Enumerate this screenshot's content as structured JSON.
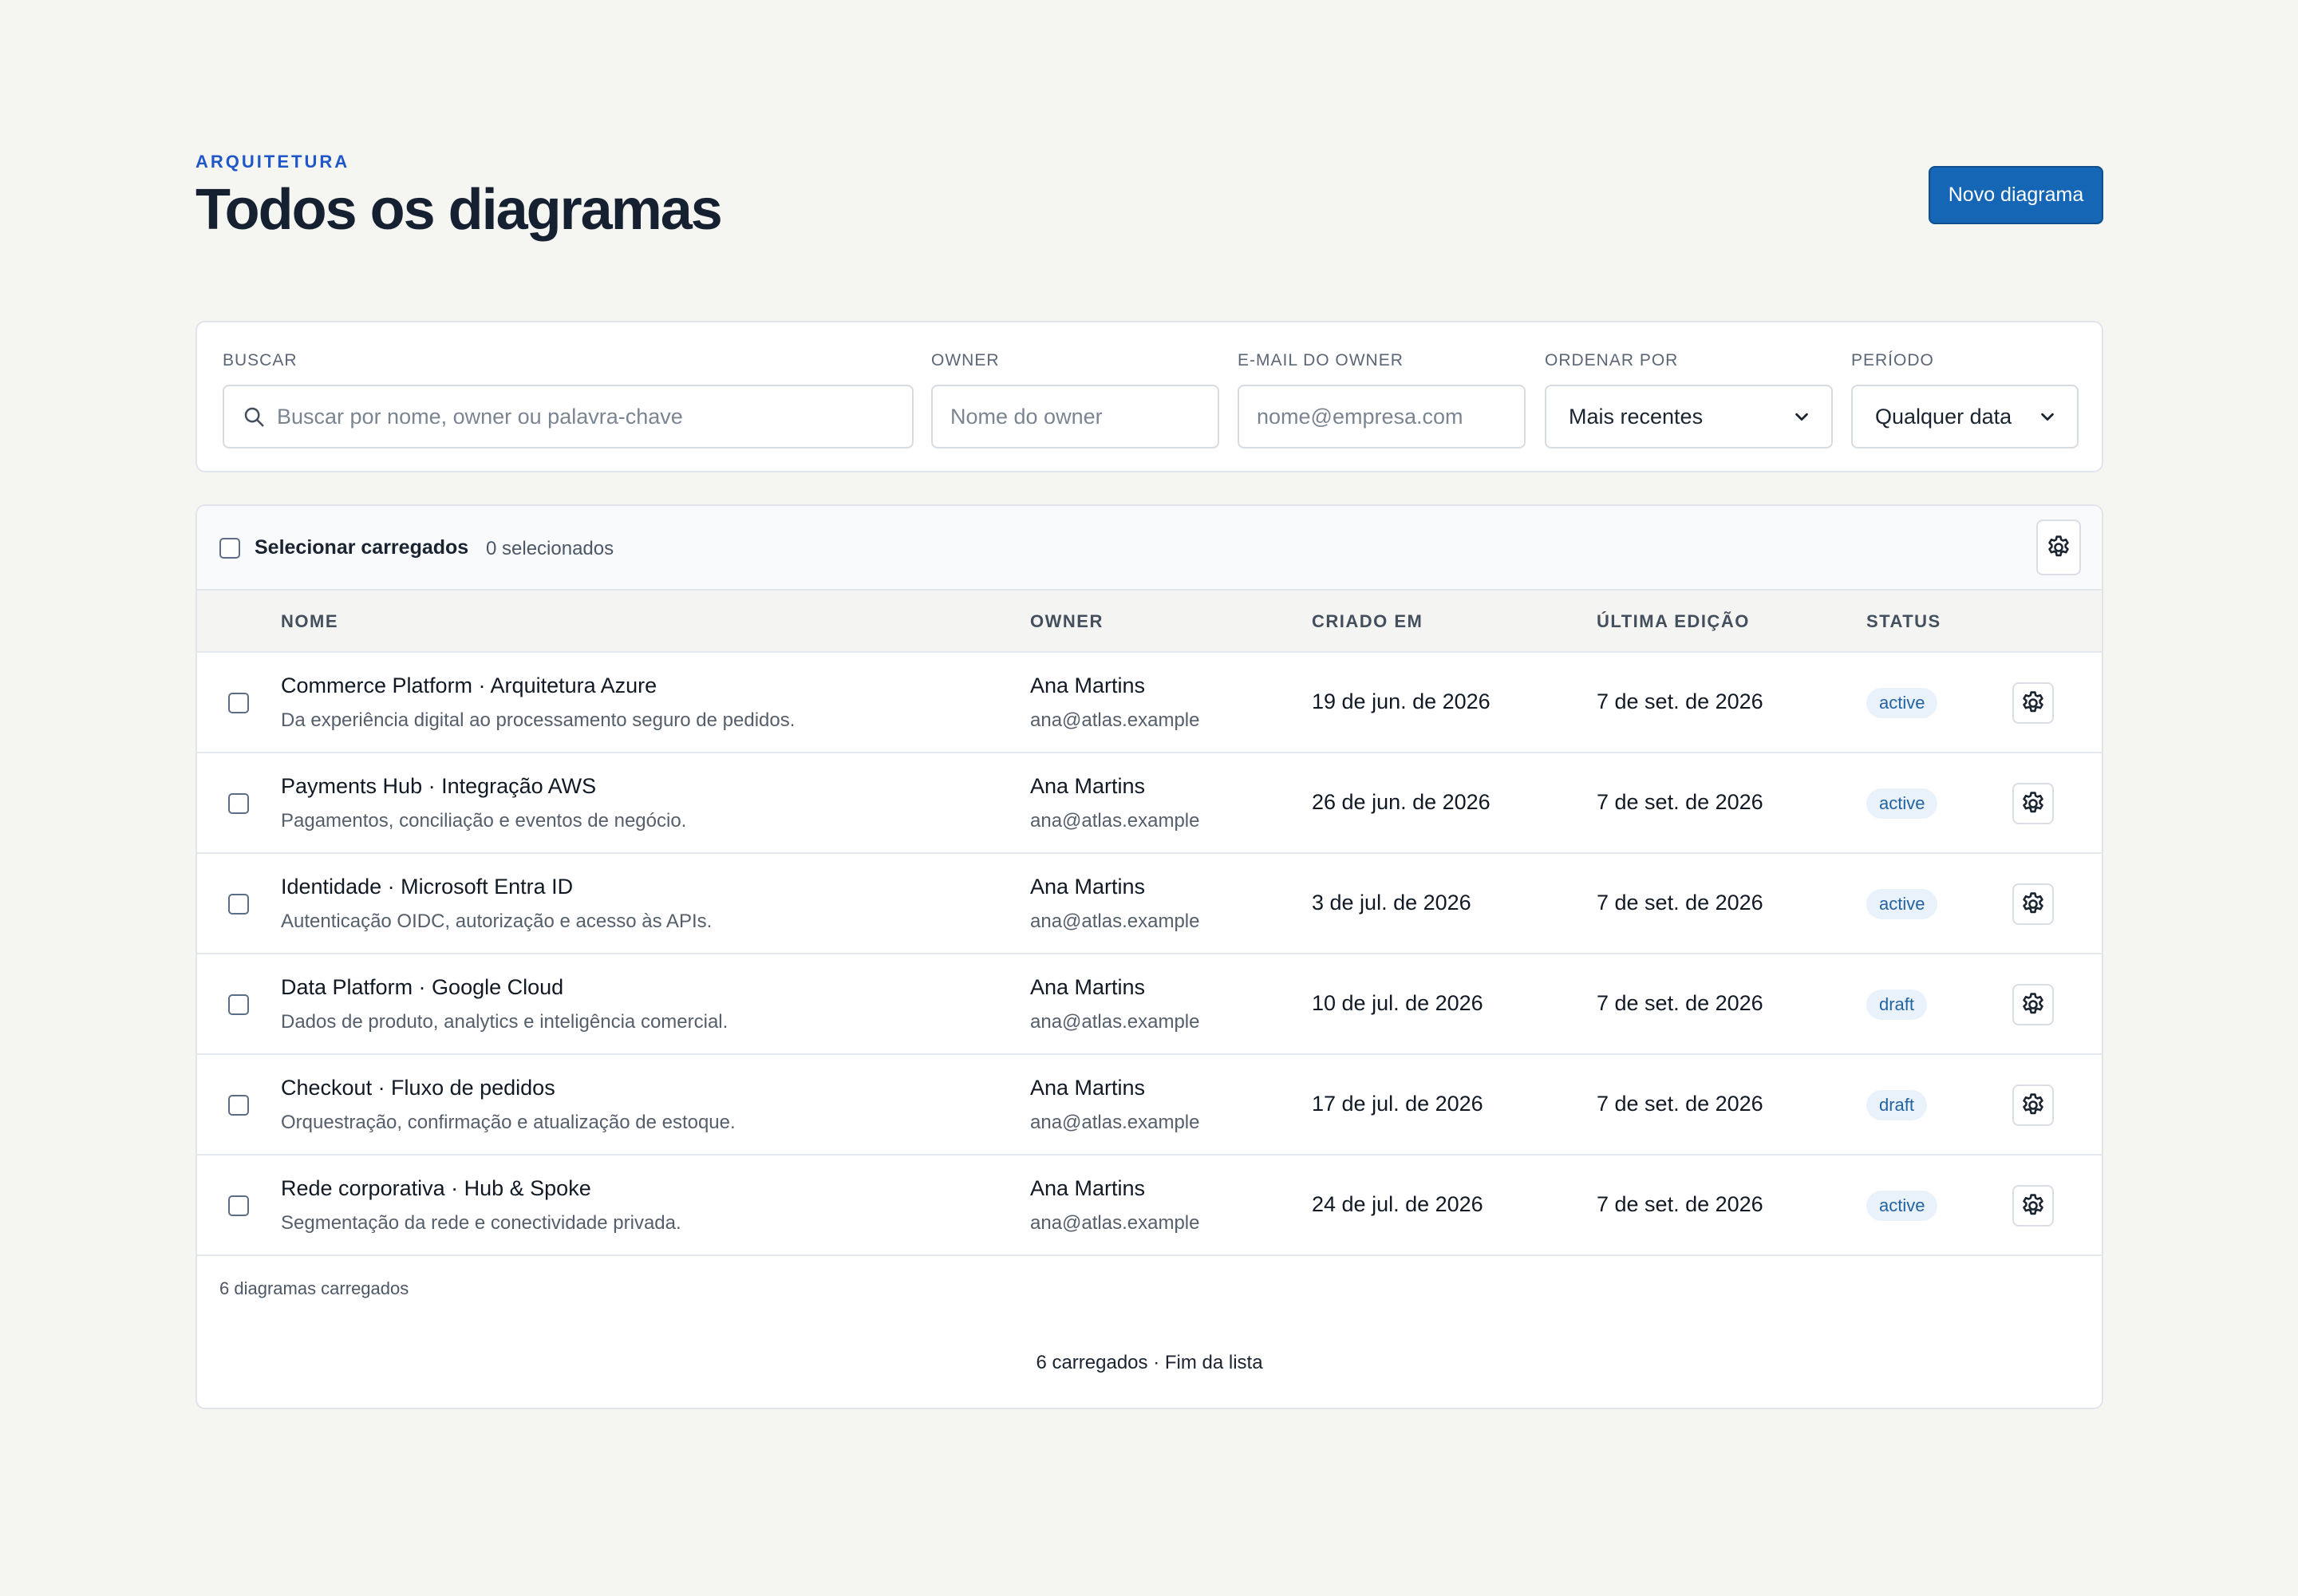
{
  "header": {
    "eyebrow": "ARQUITETURA",
    "title": "Todos os diagramas",
    "new_button": "Novo diagrama"
  },
  "filters": {
    "search": {
      "label": "BUSCAR",
      "placeholder": "Buscar por nome, owner ou palavra-chave",
      "value": ""
    },
    "owner": {
      "label": "OWNER",
      "placeholder": "Nome do owner",
      "value": ""
    },
    "owner_email": {
      "label": "E-MAIL DO OWNER",
      "placeholder": "nome@empresa.com",
      "value": ""
    },
    "sort": {
      "label": "ORDENAR POR",
      "value": "Mais recentes"
    },
    "period": {
      "label": "PERÍODO",
      "value": "Qualquer data"
    }
  },
  "toolbar": {
    "select_loaded": "Selecionar carregados",
    "selected_count": "0 selecionados"
  },
  "table": {
    "columns": {
      "name": "NOME",
      "owner": "OWNER",
      "created": "CRIADO EM",
      "edited": "ÚLTIMA EDIÇÃO",
      "status": "STATUS"
    },
    "rows": [
      {
        "name": "Commerce Platform · Arquitetura Azure",
        "description": "Da experiência digital ao processamento seguro de pedidos.",
        "owner": "Ana Martins",
        "email": "ana@atlas.example",
        "created": "19 de jun. de 2026",
        "edited": "7 de set. de 2026",
        "status": "active"
      },
      {
        "name": "Payments Hub · Integração AWS",
        "description": "Pagamentos, conciliação e eventos de negócio.",
        "owner": "Ana Martins",
        "email": "ana@atlas.example",
        "created": "26 de jun. de 2026",
        "edited": "7 de set. de 2026",
        "status": "active"
      },
      {
        "name": "Identidade · Microsoft Entra ID",
        "description": "Autenticação OIDC, autorização e acesso às APIs.",
        "owner": "Ana Martins",
        "email": "ana@atlas.example",
        "created": "3 de jul. de 2026",
        "edited": "7 de set. de 2026",
        "status": "active"
      },
      {
        "name": "Data Platform · Google Cloud",
        "description": "Dados de produto, analytics e inteligência comercial.",
        "owner": "Ana Martins",
        "email": "ana@atlas.example",
        "created": "10 de jul. de 2026",
        "edited": "7 de set. de 2026",
        "status": "draft"
      },
      {
        "name": "Checkout · Fluxo de pedidos",
        "description": "Orquestração, confirmação e atualização de estoque.",
        "owner": "Ana Martins",
        "email": "ana@atlas.example",
        "created": "17 de jul. de 2026",
        "edited": "7 de set. de 2026",
        "status": "draft"
      },
      {
        "name": "Rede corporativa · Hub & Spoke",
        "description": "Segmentação da rede e conectividade privada.",
        "owner": "Ana Martins",
        "email": "ana@atlas.example",
        "created": "24 de jul. de 2026",
        "edited": "7 de set. de 2026",
        "status": "active"
      }
    ]
  },
  "footer": {
    "loaded_count": "6 diagramas carregados",
    "end_of_list": "6 carregados · Fim da lista"
  },
  "colors": {
    "accent": "#1566b4",
    "eyebrow": "#1f57c8",
    "badge_bg": "#e9f2fb",
    "badge_text": "#23639f"
  }
}
